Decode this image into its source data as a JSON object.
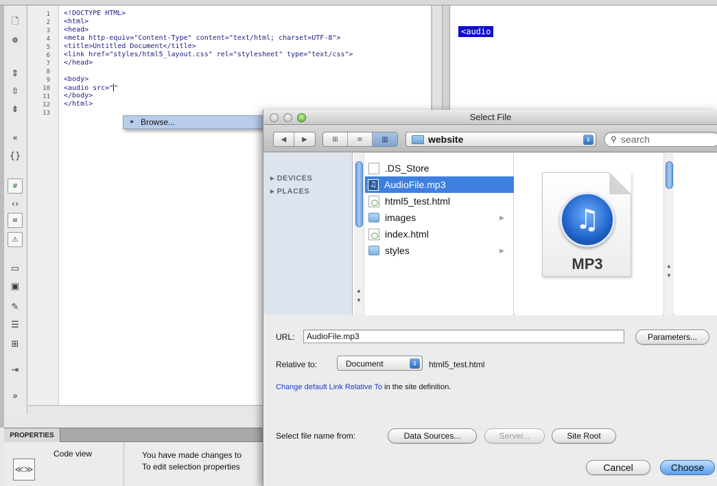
{
  "editor": {
    "line_numbers": [
      "1",
      "2",
      "3",
      "4",
      "5",
      "6",
      "7",
      "8",
      "9",
      "10",
      "11",
      "12",
      "13"
    ],
    "code_lines": [
      "<!DOCTYPE HTML>",
      "<html>",
      "<head>",
      "<meta http-equiv=\"Content-Type\" content=\"text/html; charset=UTF-8\">",
      "<title>Untitled Document</title>",
      "<link href=\"styles/html5_layout.css\" rel=\"stylesheet\" type=\"text/css\">",
      "</head>",
      "",
      "<body>",
      "<audio src=\"",
      "</body>",
      "</html>",
      ""
    ],
    "code_line10_tail": "\"",
    "design_tag": "<audio",
    "hint_popup": {
      "icon": "link-icon",
      "label": "Browse..."
    }
  },
  "toolbar_icons": [
    "document-icon",
    "bug-icon",
    "collapse-full-tag-icon",
    "collapse-selection-icon",
    "expand-all-icon",
    "select-parent-tag-icon",
    "balance-braces-icon",
    "line-numbers-icon",
    "highlight-invalid-code-icon",
    "syntax-coloring-icon",
    "word-wrap-icon",
    "apply-comment-icon",
    "remove-comment-icon",
    "wrap-tag-icon",
    "recent-snippets-icon",
    "move-css-icon",
    "indent-code-icon",
    "format-source-icon",
    "more-icon"
  ],
  "properties": {
    "tab_label": "PROPERTIES",
    "view_label": "Code view",
    "message_line1": "You have made changes to",
    "message_line2": "To edit selection properties"
  },
  "dialog": {
    "title": "Select File",
    "nav": {
      "back": "◀",
      "forward": "▶"
    },
    "view_modes": [
      "icon-view-icon",
      "list-view-icon",
      "column-view-icon"
    ],
    "folder": "website",
    "search_placeholder": "search",
    "sidebar": [
      "DEVICES",
      "PLACES"
    ],
    "files": [
      {
        "name": ".DS_Store",
        "icon": "document-icon",
        "selected": false,
        "folder": false
      },
      {
        "name": "AudioFile.mp3",
        "icon": "mp3-file-icon",
        "selected": true,
        "folder": false
      },
      {
        "name": "html5_test.html",
        "icon": "html-file-icon",
        "selected": false,
        "folder": false
      },
      {
        "name": "images",
        "icon": "folder-icon",
        "selected": false,
        "folder": true
      },
      {
        "name": "index.html",
        "icon": "html-file-icon",
        "selected": false,
        "folder": false
      },
      {
        "name": "styles",
        "icon": "folder-icon",
        "selected": false,
        "folder": true
      }
    ],
    "preview_caption": "MP3",
    "url_label": "URL:",
    "url_value": "AudioFile.mp3",
    "parameters_button": "Parameters...",
    "relative_label": "Relative to:",
    "relative_value": "Document",
    "relative_file": "html5_test.html",
    "change_link": "Change default Link Relative To",
    "change_suffix": " in the site definition.",
    "select_from_label": "Select file name from:",
    "data_sources_button": "Data Sources...",
    "server_button": "Server...",
    "site_root_button": "Site Root",
    "cancel_button": "Cancel",
    "choose_button": "Choose"
  },
  "colors": {
    "selection_blue": "#3d80df",
    "design_tag_bg": "#1010c8",
    "link_blue": "#1a3ad0"
  }
}
